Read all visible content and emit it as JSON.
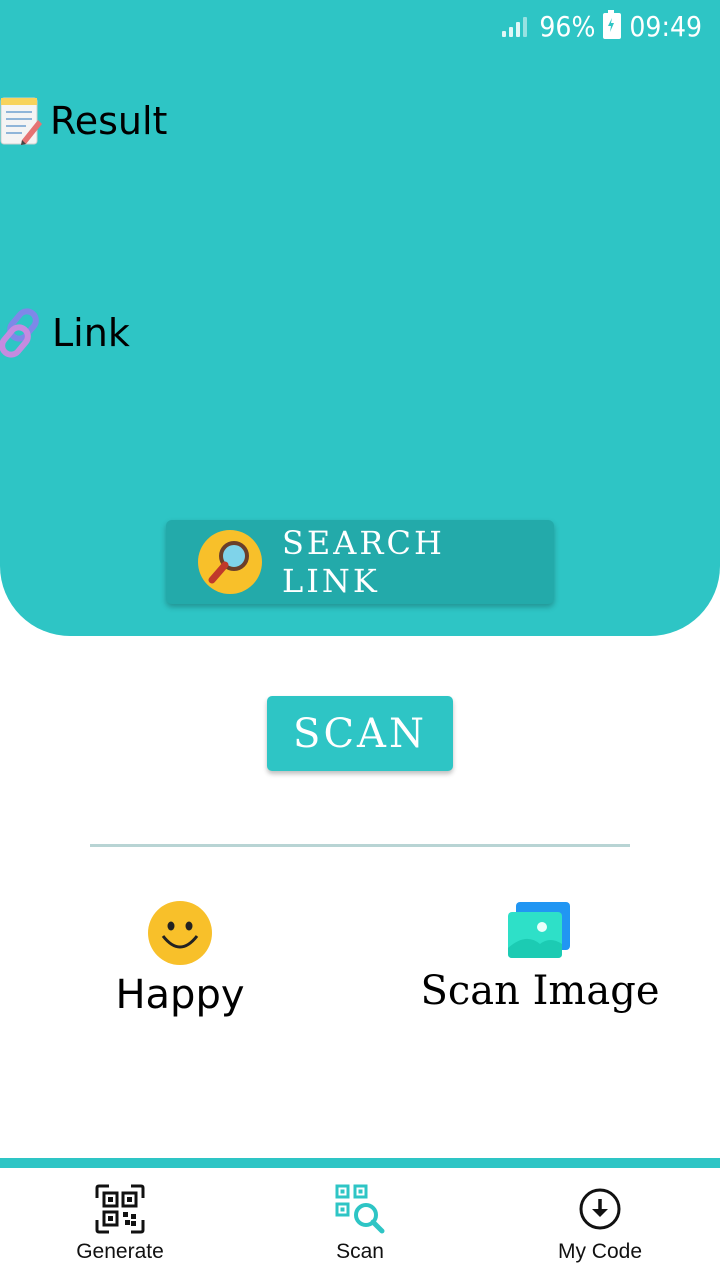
{
  "status_bar": {
    "battery_percent": "96%",
    "time": "09:49"
  },
  "result": {
    "label": "Result",
    "icon": "memo-icon"
  },
  "link": {
    "label": "Link",
    "icon": "chain-link-icon"
  },
  "search_link_button": {
    "label": "SEARCH LINK",
    "icon": "magnifier-icon"
  },
  "scan_button": {
    "label": "SCAN"
  },
  "options": [
    {
      "label": "Happy",
      "icon": "smiley-icon"
    },
    {
      "label": "Scan Image",
      "icon": "images-icon"
    }
  ],
  "bottom_nav": [
    {
      "label": "Generate",
      "icon": "qr-code-icon"
    },
    {
      "label": "Scan",
      "icon": "qr-scan-icon"
    },
    {
      "label": "My Code",
      "icon": "download-circle-icon"
    }
  ],
  "colors": {
    "accent": "#2ec5c5",
    "button_dark": "#23aaaa",
    "smiley": "#f8c02a"
  }
}
